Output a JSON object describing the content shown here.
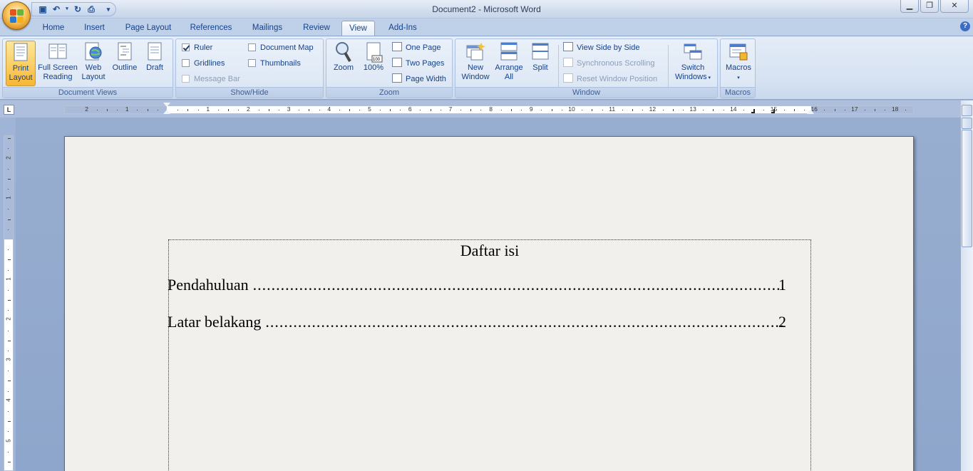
{
  "window": {
    "title": "Document2 - Microsoft Word"
  },
  "tabs": [
    "Home",
    "Insert",
    "Page Layout",
    "References",
    "Mailings",
    "Review",
    "View",
    "Add-Ins"
  ],
  "active_tab": "View",
  "ribbon": {
    "document_views": {
      "label": "Document Views",
      "buttons": [
        {
          "line1": "Print",
          "line2": "Layout",
          "active": true
        },
        {
          "line1": "Full Screen",
          "line2": "Reading"
        },
        {
          "line1": "Web",
          "line2": "Layout"
        },
        {
          "line1": "Outline",
          "line2": ""
        },
        {
          "line1": "Draft",
          "line2": ""
        }
      ]
    },
    "show_hide": {
      "label": "Show/Hide",
      "items": [
        {
          "label": "Ruler",
          "checked": true,
          "enabled": true
        },
        {
          "label": "Gridlines",
          "checked": false,
          "enabled": true
        },
        {
          "label": "Message Bar",
          "checked": false,
          "enabled": false
        },
        {
          "label": "Document Map",
          "checked": false,
          "enabled": true
        },
        {
          "label": "Thumbnails",
          "checked": false,
          "enabled": true
        }
      ]
    },
    "zoom": {
      "label": "Zoom",
      "zoom_label": "Zoom",
      "percent_label": "100%",
      "items": [
        "One Page",
        "Two Pages",
        "Page Width"
      ]
    },
    "window": {
      "label": "Window",
      "new_window": {
        "line1": "New",
        "line2": "Window"
      },
      "arrange_all": {
        "line1": "Arrange",
        "line2": "All"
      },
      "split": "Split",
      "items": [
        {
          "label": "View Side by Side",
          "enabled": true
        },
        {
          "label": "Synchronous Scrolling",
          "enabled": false
        },
        {
          "label": "Reset Window Position",
          "enabled": false
        }
      ],
      "switch_windows": {
        "line1": "Switch",
        "line2": "Windows"
      }
    },
    "macros": {
      "label": "Macros",
      "button": "Macros"
    }
  },
  "ruler": {
    "corner": "L",
    "left_numbers": [
      "2",
      "1"
    ],
    "right_numbers": [
      "1",
      "2",
      "3",
      "4",
      "5",
      "6",
      "7",
      "8",
      "9",
      "10",
      "11",
      "12",
      "13",
      "14",
      "15",
      "16",
      "17",
      "18"
    ],
    "vertical_numbers": [
      "2",
      "1",
      "1",
      "2",
      "3",
      "4",
      "5"
    ]
  },
  "document": {
    "toc_title": "Daftar isi",
    "entries": [
      {
        "text": "Pendahuluan",
        "page": "1"
      },
      {
        "text": "Latar belakang",
        "page": "2"
      }
    ]
  }
}
